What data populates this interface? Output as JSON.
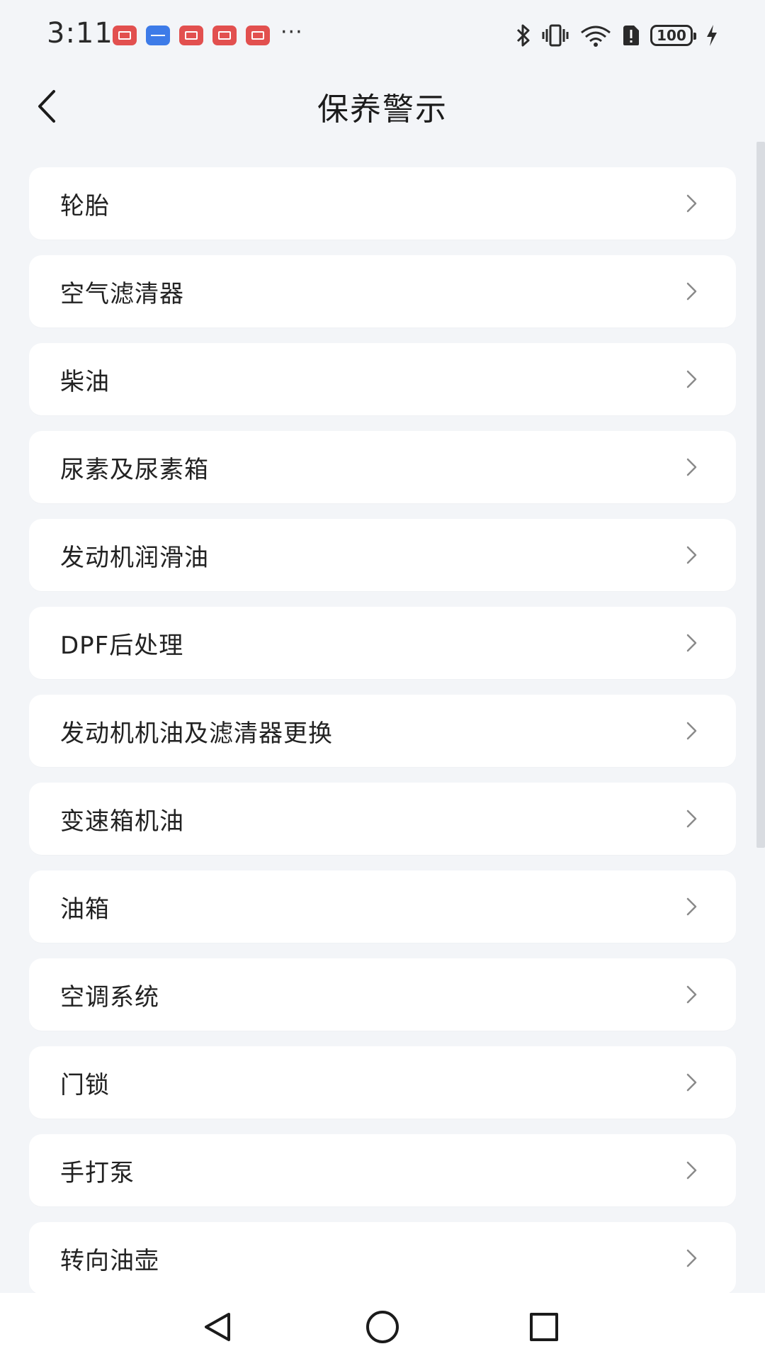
{
  "status_bar": {
    "time": "3:11",
    "more": "···",
    "battery_level": "100",
    "notification_colors": [
      "#e2504f",
      "#3d7be8",
      "#e2504f",
      "#e2504f",
      "#e2504f"
    ]
  },
  "header": {
    "title": "保养警示",
    "back_icon": "chevron-left-icon"
  },
  "list": {
    "items": [
      {
        "label": "轮胎"
      },
      {
        "label": "空气滤清器"
      },
      {
        "label": "柴油"
      },
      {
        "label": "尿素及尿素箱"
      },
      {
        "label": "发动机润滑油"
      },
      {
        "label": "DPF后处理"
      },
      {
        "label": "发动机机油及滤清器更换"
      },
      {
        "label": "变速箱机油"
      },
      {
        "label": "油箱"
      },
      {
        "label": "空调系统"
      },
      {
        "label": "门锁"
      },
      {
        "label": "手打泵"
      },
      {
        "label": "转向油壶"
      }
    ],
    "chevron_icon": "chevron-right-icon"
  },
  "nav_bar": {
    "back": "triangle-back-icon",
    "home": "circle-home-icon",
    "recents": "square-recents-icon"
  },
  "colors": {
    "background": "#f3f5f8",
    "card": "#ffffff",
    "text": "#222222",
    "chevron": "#8a8a8a"
  }
}
